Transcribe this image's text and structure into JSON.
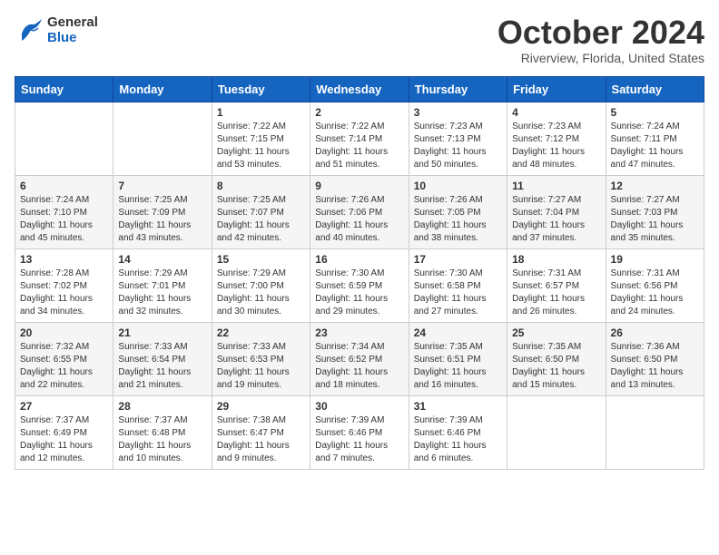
{
  "header": {
    "logo_general": "General",
    "logo_blue": "Blue",
    "month": "October 2024",
    "location": "Riverview, Florida, United States"
  },
  "weekdays": [
    "Sunday",
    "Monday",
    "Tuesday",
    "Wednesday",
    "Thursday",
    "Friday",
    "Saturday"
  ],
  "weeks": [
    [
      {
        "day": "",
        "info": ""
      },
      {
        "day": "",
        "info": ""
      },
      {
        "day": "1",
        "info": "Sunrise: 7:22 AM\nSunset: 7:15 PM\nDaylight: 11 hours\nand 53 minutes."
      },
      {
        "day": "2",
        "info": "Sunrise: 7:22 AM\nSunset: 7:14 PM\nDaylight: 11 hours\nand 51 minutes."
      },
      {
        "day": "3",
        "info": "Sunrise: 7:23 AM\nSunset: 7:13 PM\nDaylight: 11 hours\nand 50 minutes."
      },
      {
        "day": "4",
        "info": "Sunrise: 7:23 AM\nSunset: 7:12 PM\nDaylight: 11 hours\nand 48 minutes."
      },
      {
        "day": "5",
        "info": "Sunrise: 7:24 AM\nSunset: 7:11 PM\nDaylight: 11 hours\nand 47 minutes."
      }
    ],
    [
      {
        "day": "6",
        "info": "Sunrise: 7:24 AM\nSunset: 7:10 PM\nDaylight: 11 hours\nand 45 minutes."
      },
      {
        "day": "7",
        "info": "Sunrise: 7:25 AM\nSunset: 7:09 PM\nDaylight: 11 hours\nand 43 minutes."
      },
      {
        "day": "8",
        "info": "Sunrise: 7:25 AM\nSunset: 7:07 PM\nDaylight: 11 hours\nand 42 minutes."
      },
      {
        "day": "9",
        "info": "Sunrise: 7:26 AM\nSunset: 7:06 PM\nDaylight: 11 hours\nand 40 minutes."
      },
      {
        "day": "10",
        "info": "Sunrise: 7:26 AM\nSunset: 7:05 PM\nDaylight: 11 hours\nand 38 minutes."
      },
      {
        "day": "11",
        "info": "Sunrise: 7:27 AM\nSunset: 7:04 PM\nDaylight: 11 hours\nand 37 minutes."
      },
      {
        "day": "12",
        "info": "Sunrise: 7:27 AM\nSunset: 7:03 PM\nDaylight: 11 hours\nand 35 minutes."
      }
    ],
    [
      {
        "day": "13",
        "info": "Sunrise: 7:28 AM\nSunset: 7:02 PM\nDaylight: 11 hours\nand 34 minutes."
      },
      {
        "day": "14",
        "info": "Sunrise: 7:29 AM\nSunset: 7:01 PM\nDaylight: 11 hours\nand 32 minutes."
      },
      {
        "day": "15",
        "info": "Sunrise: 7:29 AM\nSunset: 7:00 PM\nDaylight: 11 hours\nand 30 minutes."
      },
      {
        "day": "16",
        "info": "Sunrise: 7:30 AM\nSunset: 6:59 PM\nDaylight: 11 hours\nand 29 minutes."
      },
      {
        "day": "17",
        "info": "Sunrise: 7:30 AM\nSunset: 6:58 PM\nDaylight: 11 hours\nand 27 minutes."
      },
      {
        "day": "18",
        "info": "Sunrise: 7:31 AM\nSunset: 6:57 PM\nDaylight: 11 hours\nand 26 minutes."
      },
      {
        "day": "19",
        "info": "Sunrise: 7:31 AM\nSunset: 6:56 PM\nDaylight: 11 hours\nand 24 minutes."
      }
    ],
    [
      {
        "day": "20",
        "info": "Sunrise: 7:32 AM\nSunset: 6:55 PM\nDaylight: 11 hours\nand 22 minutes."
      },
      {
        "day": "21",
        "info": "Sunrise: 7:33 AM\nSunset: 6:54 PM\nDaylight: 11 hours\nand 21 minutes."
      },
      {
        "day": "22",
        "info": "Sunrise: 7:33 AM\nSunset: 6:53 PM\nDaylight: 11 hours\nand 19 minutes."
      },
      {
        "day": "23",
        "info": "Sunrise: 7:34 AM\nSunset: 6:52 PM\nDaylight: 11 hours\nand 18 minutes."
      },
      {
        "day": "24",
        "info": "Sunrise: 7:35 AM\nSunset: 6:51 PM\nDaylight: 11 hours\nand 16 minutes."
      },
      {
        "day": "25",
        "info": "Sunrise: 7:35 AM\nSunset: 6:50 PM\nDaylight: 11 hours\nand 15 minutes."
      },
      {
        "day": "26",
        "info": "Sunrise: 7:36 AM\nSunset: 6:50 PM\nDaylight: 11 hours\nand 13 minutes."
      }
    ],
    [
      {
        "day": "27",
        "info": "Sunrise: 7:37 AM\nSunset: 6:49 PM\nDaylight: 11 hours\nand 12 minutes."
      },
      {
        "day": "28",
        "info": "Sunrise: 7:37 AM\nSunset: 6:48 PM\nDaylight: 11 hours\nand 10 minutes."
      },
      {
        "day": "29",
        "info": "Sunrise: 7:38 AM\nSunset: 6:47 PM\nDaylight: 11 hours\nand 9 minutes."
      },
      {
        "day": "30",
        "info": "Sunrise: 7:39 AM\nSunset: 6:46 PM\nDaylight: 11 hours\nand 7 minutes."
      },
      {
        "day": "31",
        "info": "Sunrise: 7:39 AM\nSunset: 6:46 PM\nDaylight: 11 hours\nand 6 minutes."
      },
      {
        "day": "",
        "info": ""
      },
      {
        "day": "",
        "info": ""
      }
    ]
  ]
}
